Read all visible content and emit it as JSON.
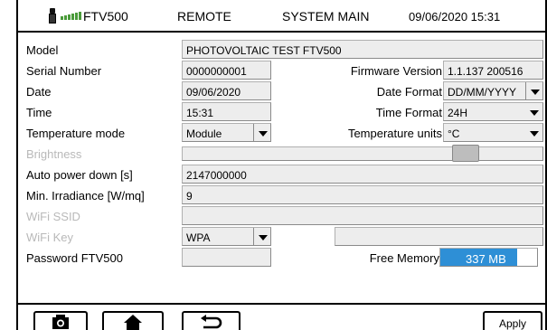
{
  "header": {
    "device_name": "FTV500",
    "mode": "REMOTE",
    "screen_title": "SYSTEM MAIN",
    "datetime": "09/06/2020 15:31",
    "icons": [
      "usb-icon",
      "battery-icon"
    ]
  },
  "form": {
    "model": {
      "label": "Model",
      "value": "PHOTOVOLTAIC TEST FTV500"
    },
    "serial": {
      "label": "Serial Number",
      "value": "0000000001"
    },
    "firmware": {
      "label": "Firmware Version",
      "value": "1.1.137 200516"
    },
    "date": {
      "label": "Date",
      "value": "09/06/2020"
    },
    "date_format": {
      "label": "Date Format",
      "value": "DD/MM/YYYY"
    },
    "time": {
      "label": "Time",
      "value": "15:31"
    },
    "time_format": {
      "label": "Time Format",
      "value": "24H"
    },
    "temp_mode": {
      "label": "Temperature mode",
      "value": "Module"
    },
    "temp_units": {
      "label": "Temperature units",
      "value": "°C"
    },
    "brightness": {
      "label": "Brightness",
      "level": 0.81
    },
    "auto_power": {
      "label": "Auto power down [s]",
      "value": "2147000000"
    },
    "irradiance": {
      "label": "Min. Irradiance [W/mq]",
      "value": "9"
    },
    "wifi_ssid": {
      "label": "WiFi SSID",
      "value": ""
    },
    "wifi_key": {
      "label": "WiFi Key",
      "security": "WPA",
      "value": ""
    },
    "password": {
      "label": "Password FTV500",
      "value": ""
    },
    "free_memory": {
      "label": "Free Memory",
      "value": "337 MB",
      "fill_fraction": 0.79
    }
  },
  "toolbar": {
    "camera_icon": "camera-icon",
    "home_icon": "home-icon",
    "back_icon": "back-arrow-icon",
    "apply_label": "Apply"
  },
  "colors": {
    "memory_bar": "#2e8fd6",
    "field_bg": "#ededed",
    "disabled_text": "#b9b9b9",
    "battery": "#4a9b3a"
  }
}
